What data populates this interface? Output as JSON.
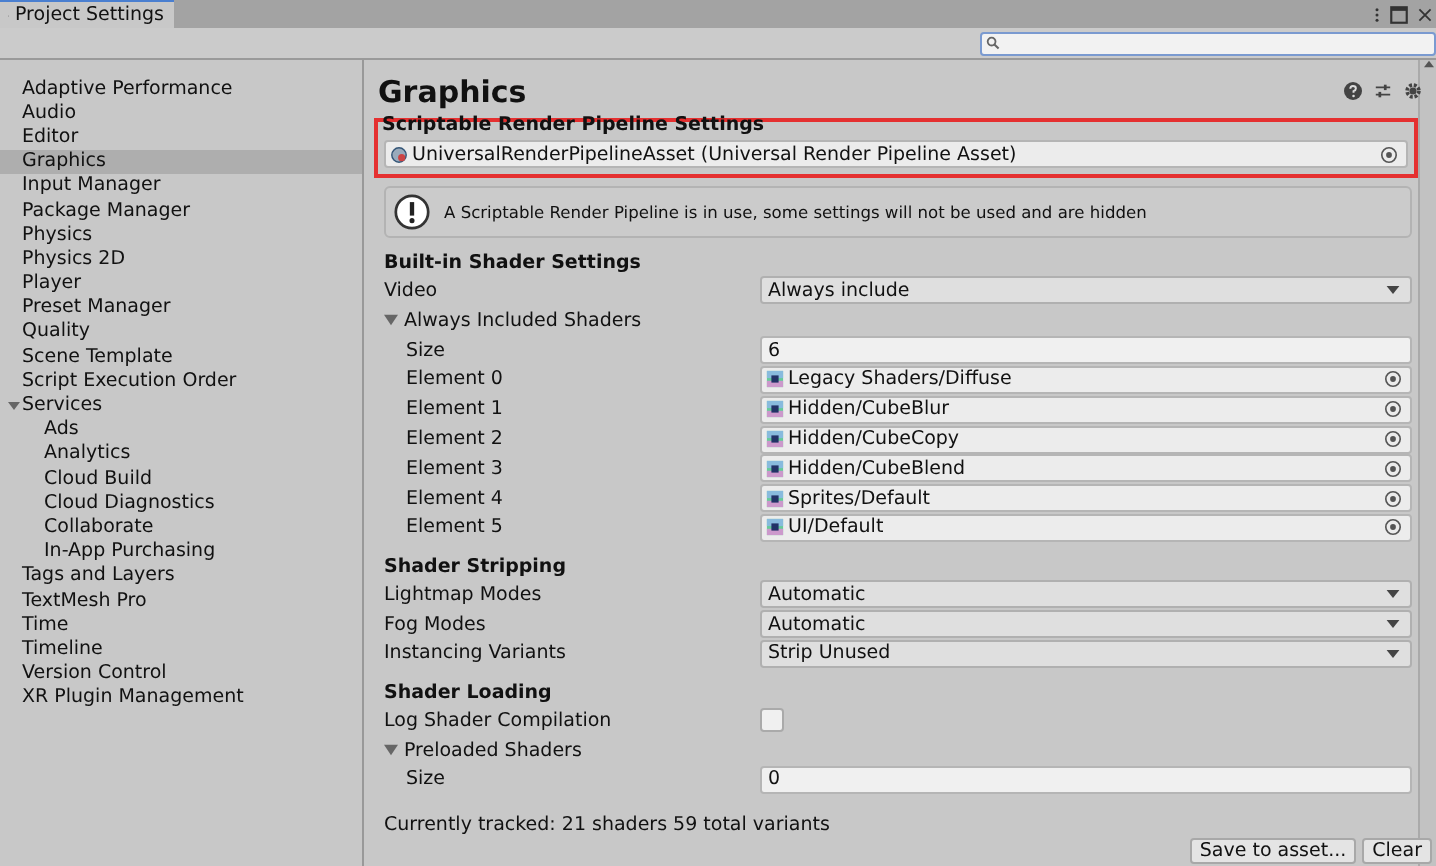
{
  "window": {
    "title": "Project Settings"
  },
  "sidebar": {
    "items": [
      {
        "label": "Adaptive Performance",
        "selected": false
      },
      {
        "label": "Audio",
        "selected": false
      },
      {
        "label": "Editor",
        "selected": false
      },
      {
        "label": "Graphics",
        "selected": true
      },
      {
        "label": "Input Manager",
        "selected": false
      },
      {
        "label": "Package Manager",
        "selected": false
      },
      {
        "label": "Physics",
        "selected": false
      },
      {
        "label": "Physics 2D",
        "selected": false
      },
      {
        "label": "Player",
        "selected": false
      },
      {
        "label": "Preset Manager",
        "selected": false
      },
      {
        "label": "Quality",
        "selected": false
      },
      {
        "label": "Scene Template",
        "selected": false
      },
      {
        "label": "Script Execution Order",
        "selected": false
      },
      {
        "label": "Services",
        "selected": false,
        "expanded": true,
        "children": [
          {
            "label": "Ads",
            "selected": false
          },
          {
            "label": "Analytics",
            "selected": false
          },
          {
            "label": "Cloud Build",
            "selected": false
          },
          {
            "label": "Cloud Diagnostics",
            "selected": false
          },
          {
            "label": "Collaborate",
            "selected": false
          },
          {
            "label": "In-App Purchasing",
            "selected": false
          }
        ]
      },
      {
        "label": "Tags and Layers",
        "selected": false
      },
      {
        "label": "TextMesh Pro",
        "selected": false
      },
      {
        "label": "Time",
        "selected": false
      },
      {
        "label": "Timeline",
        "selected": false
      },
      {
        "label": "Version Control",
        "selected": false
      },
      {
        "label": "XR Plugin Management",
        "selected": false
      }
    ]
  },
  "content": {
    "title": "Graphics",
    "pipeline": {
      "label": "Scriptable Render Pipeline Settings",
      "value": "UniversalRenderPipelineAsset (Universal Render Pipeline Asset)",
      "highlighted": true
    },
    "info": "A Scriptable Render Pipeline is in use, some settings will not be used and are hidden",
    "sections": [
      {
        "heading": "Built-in Shader Settings",
        "rows": [
          {
            "kind": "dropdown",
            "label": "Video",
            "value": "Always include"
          },
          {
            "kind": "foldout",
            "label": "Always Included Shaders",
            "expanded": true,
            "children": [
              {
                "kind": "number",
                "label": "Size",
                "value": "6"
              },
              {
                "kind": "object",
                "label": "Element 0",
                "value": "Legacy Shaders/Diffuse"
              },
              {
                "kind": "object",
                "label": "Element 1",
                "value": "Hidden/CubeBlur"
              },
              {
                "kind": "object",
                "label": "Element 2",
                "value": "Hidden/CubeCopy"
              },
              {
                "kind": "object",
                "label": "Element 3",
                "value": "Hidden/CubeBlend"
              },
              {
                "kind": "object",
                "label": "Element 4",
                "value": "Sprites/Default"
              },
              {
                "kind": "object",
                "label": "Element 5",
                "value": "UI/Default"
              }
            ]
          }
        ]
      },
      {
        "heading": "Shader Stripping",
        "rows": [
          {
            "kind": "dropdown",
            "label": "Lightmap Modes",
            "value": "Automatic"
          },
          {
            "kind": "dropdown",
            "label": "Fog Modes",
            "value": "Automatic"
          },
          {
            "kind": "dropdown",
            "label": "Instancing Variants",
            "value": "Strip Unused"
          }
        ]
      },
      {
        "heading": "Shader Loading",
        "rows": [
          {
            "kind": "checkbox",
            "label": "Log Shader Compilation",
            "checked": false
          },
          {
            "kind": "foldout",
            "label": "Preloaded Shaders",
            "expanded": true,
            "children": [
              {
                "kind": "number",
                "label": "Size",
                "value": "0"
              }
            ]
          }
        ]
      }
    ],
    "status": "Currently tracked: 21 shaders 59 total variants",
    "buttons": [
      "Save to asset...",
      "Clear"
    ]
  }
}
